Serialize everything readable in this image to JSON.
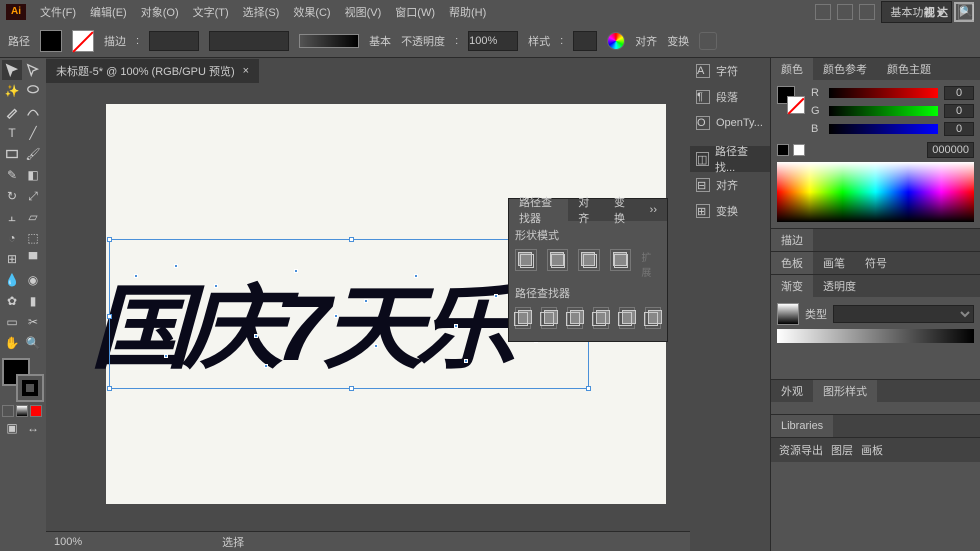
{
  "menu": {
    "file": "文件(F)",
    "edit": "编辑(E)",
    "object": "对象(O)",
    "type": "文字(T)",
    "select": "选择(S)",
    "effect": "效果(C)",
    "view": "视图(V)",
    "window": "窗口(W)",
    "help": "帮助(H)"
  },
  "workspace_label": "基本功能",
  "toolbar": {
    "path_label": "路径",
    "stroke_label": "描边",
    "stroke_weight": "",
    "basic": "基本",
    "opacity_label": "不透明度",
    "opacity": "100%",
    "style_label": "样式",
    "align": "对齐",
    "transform": "变换"
  },
  "doc": {
    "tab": "未标题-5* @ 100% (RGB/GPU 预览)",
    "close": "×"
  },
  "artwork_text": "国庆7天乐",
  "status": {
    "zoom": "100%",
    "mode": "选择"
  },
  "dock": {
    "char": "字符",
    "para": "段落",
    "opentype": "OpenTy...",
    "pathfinder": "路径查找...",
    "align": "对齐",
    "transform": "变换"
  },
  "panels": {
    "color": {
      "tab": "颜色",
      "guide": "颜色参考",
      "themes": "颜色主题",
      "r": "R",
      "g": "G",
      "b": "B",
      "rv": "0",
      "gv": "0",
      "bv": "0",
      "hex": "000000"
    },
    "stroke": {
      "tab": "描边"
    },
    "swatches": {
      "tab": "色板",
      "brushes": "画笔",
      "symbols": "符号"
    },
    "gradient": {
      "tab": "渐变",
      "transparency": "透明度",
      "type_label": "类型"
    },
    "appearance": {
      "tab": "外观",
      "graphic_styles": "图形样式"
    },
    "libraries": {
      "tab": "Libraries"
    },
    "asset": {
      "export": "资源导出",
      "layers": "图层",
      "artboards": "画板"
    }
  },
  "pathfinder": {
    "tab1": "路径查找器",
    "tab2": "对齐",
    "tab3": "变换",
    "shape_modes": "形状模式",
    "pathfinders": "路径查找器",
    "expand": "扩展"
  },
  "shape_strip": {
    "close": "×"
  },
  "watermark": "视达"
}
